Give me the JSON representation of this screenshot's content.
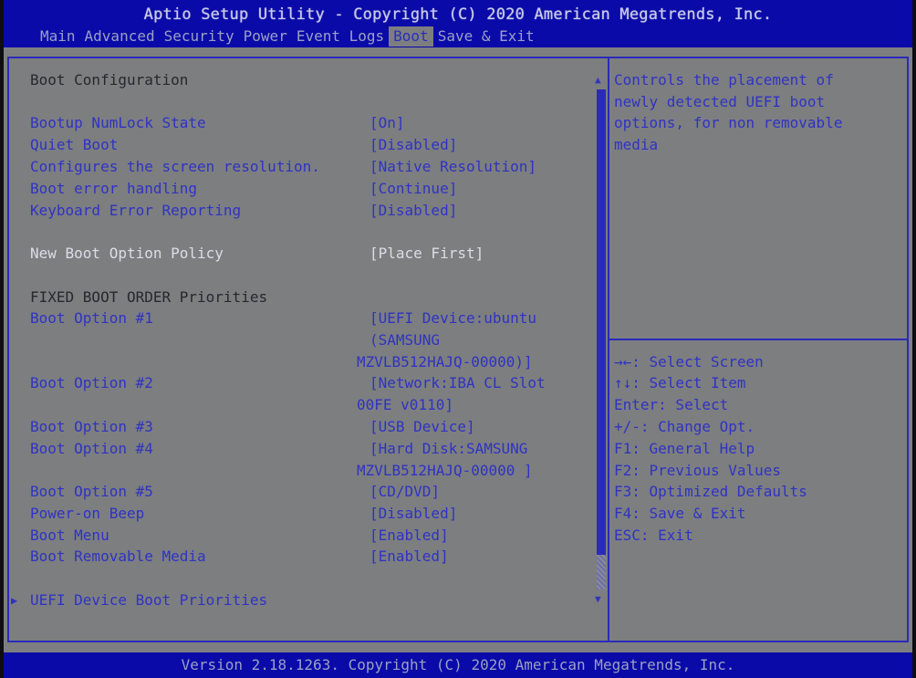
{
  "header": {
    "title": "Aptio Setup Utility - Copyright (C) 2020 American Megatrends, Inc.",
    "tabs": [
      {
        "label": "Main"
      },
      {
        "label": "Advanced"
      },
      {
        "label": "Security"
      },
      {
        "label": "Power"
      },
      {
        "label": "Event Logs"
      },
      {
        "label": "Boot",
        "active": true
      },
      {
        "label": "Save & Exit"
      }
    ]
  },
  "main": {
    "section_title": "Boot Configuration",
    "settings": [
      {
        "label": "Bootup NumLock State",
        "value": "[On]"
      },
      {
        "label": "Quiet Boot",
        "value": "[Disabled]"
      },
      {
        "label": "Configures the screen resolution.",
        "value": "[Native Resolution]"
      },
      {
        "label": "Boot error handling",
        "value": "[Continue]"
      },
      {
        "label": "Keyboard Error Reporting",
        "value": "[Disabled]"
      },
      {
        "label": "New Boot Option Policy",
        "value": "[Place First]",
        "selected": true
      }
    ],
    "fixed_boot_order_title": "FIXED BOOT ORDER Priorities",
    "boot_options": [
      {
        "label": "Boot Option #1",
        "value_lines": [
          "[UEFI Device:ubuntu",
          "(SAMSUNG",
          "MZVLB512HAJQ-00000)]"
        ]
      },
      {
        "label": "Boot Option #2",
        "value_lines": [
          "[Network:IBA CL Slot",
          "00FE v0110]"
        ]
      },
      {
        "label": "Boot Option #3",
        "value_lines": [
          "[USB Device]"
        ]
      },
      {
        "label": "Boot Option #4",
        "value_lines": [
          "[Hard Disk:SAMSUNG",
          "MZVLB512HAJQ-00000 ]"
        ]
      },
      {
        "label": "Boot Option #5",
        "value_lines": [
          "[CD/DVD]"
        ]
      }
    ],
    "other_settings": [
      {
        "label": "Power-on Beep",
        "value": "[Disabled]"
      },
      {
        "label": "Boot Menu",
        "value": "[Enabled]"
      },
      {
        "label": "Boot Removable Media",
        "value": "[Enabled]"
      }
    ],
    "submenu": {
      "label": "UEFI Device Boot Priorities"
    },
    "scrollbar": {
      "position_fraction": 0.0,
      "visible_fraction": 0.93
    }
  },
  "help": {
    "lines": [
      "Controls the placement of",
      "newly detected UEFI boot",
      "options, for non removable",
      "media"
    ]
  },
  "keys": [
    "→←: Select Screen",
    "↑↓: Select Item",
    "Enter: Select",
    "+/-: Change Opt.",
    "F1: General Help",
    "F2: Previous Values",
    "F3: Optimized Defaults",
    "F4: Save & Exit",
    "ESC: Exit"
  ],
  "footer": {
    "text": "Version 2.18.1263. Copyright (C) 2020 American Megatrends, Inc."
  }
}
